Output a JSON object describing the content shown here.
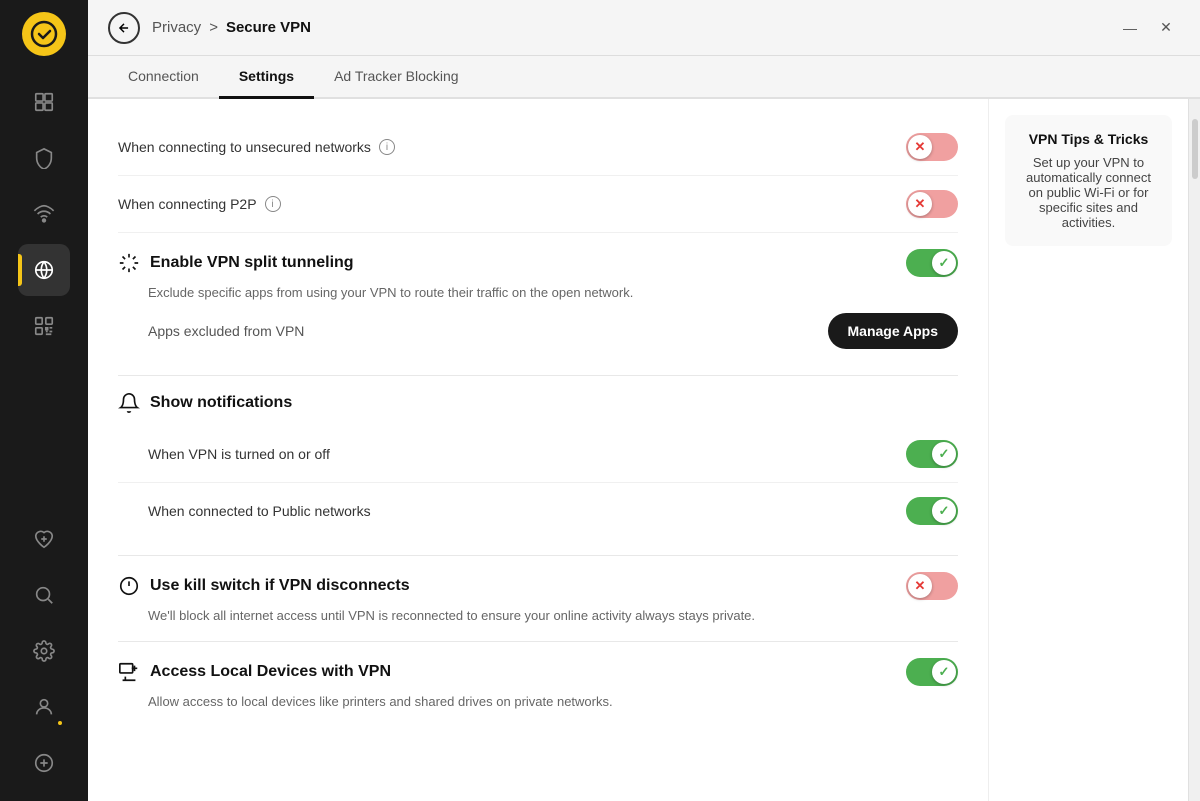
{
  "sidebar": {
    "items": [
      {
        "id": "home",
        "icon": "home",
        "active": false
      },
      {
        "id": "shield",
        "icon": "shield",
        "active": false
      },
      {
        "id": "wifi",
        "icon": "wifi",
        "active": false
      },
      {
        "id": "vpn",
        "icon": "vpn",
        "active": true
      },
      {
        "id": "scan",
        "icon": "scan",
        "active": false
      },
      {
        "id": "plus",
        "icon": "plus",
        "active": false
      },
      {
        "id": "search",
        "icon": "search",
        "active": false
      },
      {
        "id": "settings",
        "icon": "settings",
        "active": false
      },
      {
        "id": "profile",
        "icon": "profile",
        "active": false
      },
      {
        "id": "chat",
        "icon": "chat",
        "active": false
      }
    ]
  },
  "titlebar": {
    "back_label": "←",
    "breadcrumb_parent": "Privacy",
    "breadcrumb_separator": ">",
    "breadcrumb_current": "Secure VPN",
    "minimize_label": "—",
    "close_label": "✕"
  },
  "tabs": [
    {
      "id": "connection",
      "label": "Connection"
    },
    {
      "id": "settings",
      "label": "Settings",
      "active": true
    },
    {
      "id": "ad-tracker-blocking",
      "label": "Ad Tracker Blocking"
    }
  ],
  "tips": {
    "title": "VPN Tips & Tricks",
    "description": "Set up your VPN to automatically connect on public Wi-Fi or for specific sites and activities."
  },
  "settings": {
    "unsecured_label": "When connecting to unsecured networks",
    "p2p_label": "When connecting P2P",
    "split_tunneling": {
      "title": "Enable VPN split tunneling",
      "description": "Exclude specific apps from using your VPN to route their traffic on the open network.",
      "apps_label": "Apps excluded from VPN",
      "manage_btn": "Manage Apps"
    },
    "notifications": {
      "title": "Show notifications",
      "vpn_toggle_label": "When VPN is turned on or off",
      "public_network_label": "When connected to Public networks"
    },
    "kill_switch": {
      "title": "Use kill switch if VPN disconnects",
      "description": "We'll block all internet access until VPN is reconnected to ensure your online activity always stays private."
    },
    "local_devices": {
      "title": "Access Local Devices with VPN",
      "description": "Allow access to local devices like printers and shared drives on private networks."
    }
  }
}
